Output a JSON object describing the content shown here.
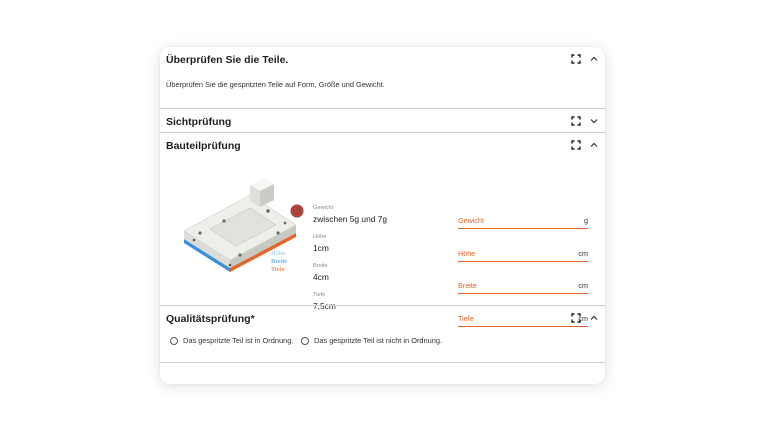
{
  "sections": {
    "check_parts": {
      "title": "Überprüfen Sie die Teile.",
      "description": "Überprüfen Sie die gespritzten Teile auf Form, Größe und Gewicht."
    },
    "visual_check": {
      "title": "Sichtprüfung"
    },
    "part_check": {
      "title": "Bauteilprüfung",
      "legend": {
        "height": "Höhe",
        "width": "Breite",
        "depth": "Tiefe"
      },
      "specs": [
        {
          "label": "Gewicht",
          "value": "zwischen 5g und 7g"
        },
        {
          "label": "Höhe",
          "value": "1cm"
        },
        {
          "label": "Breite",
          "value": "4cm"
        },
        {
          "label": "Tiefe",
          "value": "7,5cm"
        }
      ],
      "fields": [
        {
          "label": "Gewicht",
          "unit": "g"
        },
        {
          "label": "Höhe",
          "unit": "cm"
        },
        {
          "label": "Breite",
          "unit": "cm"
        },
        {
          "label": "Tiefe",
          "unit": "cm"
        }
      ]
    },
    "quality_check": {
      "title": "Qualitätsprüfung*",
      "options": [
        "Das gespritzte Teil ist in Ordnung.",
        "Das gespritzte Teil ist nicht in Ordnung."
      ]
    }
  },
  "icons": {
    "expand": "expand-icon",
    "chevron_up": "chevron-up-icon",
    "chevron_down": "chevron-down-icon",
    "no_touch": "prohibited-icon"
  },
  "colors": {
    "accent": "#e0662c",
    "height_legend": "#8fc7d8",
    "width_legend": "#3b8fd8",
    "depth_legend": "#e0662c"
  }
}
